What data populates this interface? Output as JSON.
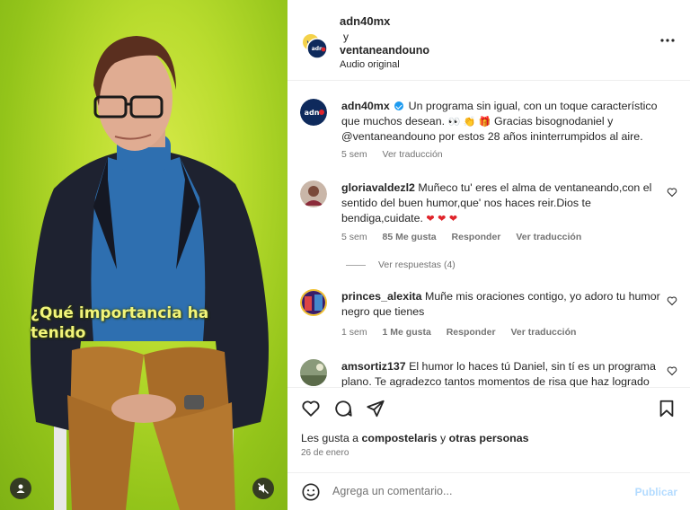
{
  "video": {
    "caption_line1": "¿Qué importancia ha",
    "caption_line2": "tenido",
    "icons": {
      "user": "user-tag-icon",
      "mute": "speaker-muted-icon"
    }
  },
  "header": {
    "author1": "adn40mx",
    "joiner": "y",
    "author2": "ventaneandouno",
    "audio": "Audio original",
    "more_icon": "more-options-icon"
  },
  "caption_comment": {
    "username": "adn40mx",
    "text": "Un programa sin igual, con un toque característico que muchos desean.",
    "emojis": "👀 👏 🎁",
    "text2": "Gracias bisognodaniel y @ventaneandouno por estos 28 años ininterrumpidos al aire.",
    "time": "5 sem",
    "translate": "Ver traducción"
  },
  "comments": [
    {
      "username": "gloriavaldezl2",
      "text": "Muñeco tu' eres el alma de ventaneando,con el sentido del buen humor,que' nos haces reir.Dios te bendiga,cuidate.",
      "hearts": "❤ ❤ ❤",
      "time": "5 sem",
      "likes": "85 Me gusta",
      "reply": "Responder",
      "translate": "Ver traducción"
    },
    {
      "username": "princes_alexita",
      "text": "Muñe mis oraciones contigo, yo adoro tu humor negro que tienes",
      "time": "1 sem",
      "likes": "1 Me gusta",
      "reply": "Responder",
      "translate": "Ver traducción"
    },
    {
      "username": "amsortiz137",
      "text": "El humor lo haces tú Daniel, sin tí es un programa plano. Te agradezco tantos momentos de risa que haz logrado"
    }
  ],
  "view_replies": "Ver respuestas (4)",
  "actions": {
    "icons": [
      "heart-icon",
      "comment-icon",
      "share-icon",
      "bookmark-icon"
    ]
  },
  "likes_line": {
    "prefix": "Les gusta a",
    "user": "compostelaris",
    "middle": "y",
    "others": "otras personas"
  },
  "date": "26 de enero",
  "add_comment": {
    "placeholder": "Agrega un comentario...",
    "post": "Publicar"
  },
  "colors": {
    "accent_link": "#0095f6",
    "post_disabled": "#b3dbff",
    "heart_red": "#e0242b",
    "muted_text": "#737373",
    "video_bg": "#b9dc2e",
    "caption_text": "#f2f57a"
  }
}
